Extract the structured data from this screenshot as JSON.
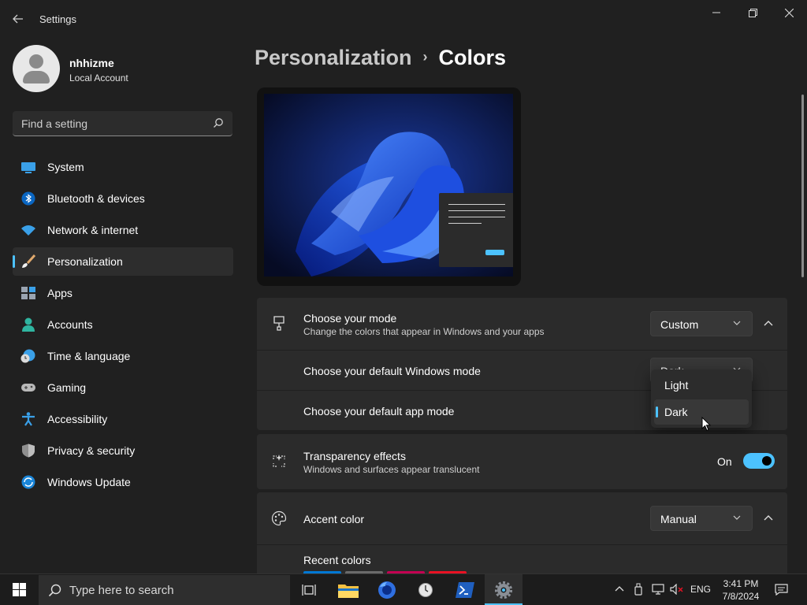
{
  "window": {
    "title": "Settings",
    "back_icon": "back-arrow-icon",
    "controls": [
      "minimize-icon",
      "restore-icon",
      "close-icon"
    ]
  },
  "user": {
    "name": "nhhizme",
    "account_type": "Local Account"
  },
  "search": {
    "placeholder": "Find a setting"
  },
  "sidebar": {
    "items": [
      {
        "label": "System",
        "icon": "system-icon"
      },
      {
        "label": "Bluetooth & devices",
        "icon": "bluetooth-icon"
      },
      {
        "label": "Network & internet",
        "icon": "wifi-icon"
      },
      {
        "label": "Personalization",
        "icon": "paintbrush-icon",
        "active": true
      },
      {
        "label": "Apps",
        "icon": "apps-icon"
      },
      {
        "label": "Accounts",
        "icon": "accounts-icon"
      },
      {
        "label": "Time & language",
        "icon": "globe-clock-icon"
      },
      {
        "label": "Gaming",
        "icon": "gamepad-icon"
      },
      {
        "label": "Accessibility",
        "icon": "accessibility-icon"
      },
      {
        "label": "Privacy & security",
        "icon": "shield-icon"
      },
      {
        "label": "Windows Update",
        "icon": "update-icon"
      }
    ]
  },
  "breadcrumb": {
    "parent": "Personalization",
    "separator": "›",
    "current": "Colors"
  },
  "mode_card": {
    "title": "Choose your mode",
    "subtitle": "Change the colors that appear in Windows and your apps",
    "value": "Custom",
    "windows_mode_label": "Choose your default Windows mode",
    "windows_mode_value": "Dark",
    "app_mode_label": "Choose your default app mode"
  },
  "dropdown": {
    "options": [
      "Light",
      "Dark"
    ],
    "selected": "Dark"
  },
  "transparency": {
    "title": "Transparency effects",
    "subtitle": "Windows and surfaces appear translucent",
    "state": "On"
  },
  "accent": {
    "title": "Accent color",
    "value": "Manual",
    "recent_label": "Recent colors",
    "recent_swatches": [
      "#0078d4",
      "#6b6b6b",
      "#c30052",
      "#e81123"
    ]
  },
  "taskbar": {
    "search_placeholder": "Type here to search",
    "apps": [
      "task-view-icon",
      "file-explorer-icon",
      "firefox-icon",
      "clock-app-icon",
      "powershell-icon",
      "settings-icon"
    ],
    "language": "ENG",
    "time": "3:41 PM",
    "date": "7/8/2024"
  },
  "colors": {
    "accent": "#4cc2ff",
    "background": "#202020",
    "card": "#2b2b2b"
  }
}
